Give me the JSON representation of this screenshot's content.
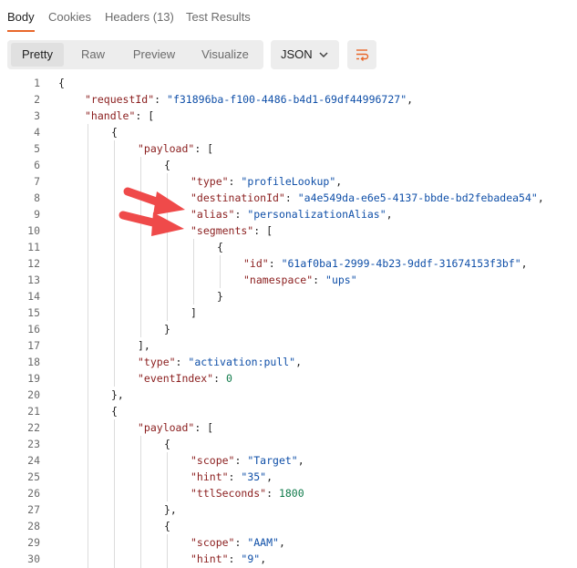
{
  "tabs": {
    "body": "Body",
    "cookies": "Cookies",
    "headers": "Headers (13)",
    "test_results": "Test Results"
  },
  "view_modes": {
    "pretty": "Pretty",
    "raw": "Raw",
    "preview": "Preview",
    "visualize": "Visualize"
  },
  "format": {
    "selected": "JSON"
  },
  "colors": {
    "accent": "#e8672a",
    "key": "#8a1d1d",
    "string": "#0f4fa8",
    "number": "#0f7a4a",
    "arrow": "#ef4a4a"
  },
  "code_lines": [
    {
      "n": "1",
      "indent": 0,
      "tokens": [
        [
          "p",
          "{"
        ]
      ]
    },
    {
      "n": "2",
      "indent": 1,
      "tokens": [
        [
          "k",
          "\"requestId\""
        ],
        [
          "p",
          ": "
        ],
        [
          "s",
          "\"f31896ba-f100-4486-b4d1-69df44996727\""
        ],
        [
          "p",
          ","
        ]
      ]
    },
    {
      "n": "3",
      "indent": 1,
      "tokens": [
        [
          "k",
          "\"handle\""
        ],
        [
          "p",
          ": ["
        ]
      ]
    },
    {
      "n": "4",
      "indent": 2,
      "tokens": [
        [
          "p",
          "{"
        ]
      ]
    },
    {
      "n": "5",
      "indent": 3,
      "tokens": [
        [
          "k",
          "\"payload\""
        ],
        [
          "p",
          ": ["
        ]
      ]
    },
    {
      "n": "6",
      "indent": 4,
      "tokens": [
        [
          "p",
          "{"
        ]
      ]
    },
    {
      "n": "7",
      "indent": 5,
      "tokens": [
        [
          "k",
          "\"type\""
        ],
        [
          "p",
          ": "
        ],
        [
          "s",
          "\"profileLookup\""
        ],
        [
          "p",
          ","
        ]
      ]
    },
    {
      "n": "8",
      "indent": 5,
      "tokens": [
        [
          "k",
          "\"destinationId\""
        ],
        [
          "p",
          ": "
        ],
        [
          "s",
          "\"a4e549da-e6e5-4137-bbde-bd2febadea54\""
        ],
        [
          "p",
          ","
        ]
      ]
    },
    {
      "n": "9",
      "indent": 5,
      "tokens": [
        [
          "k",
          "\"alias\""
        ],
        [
          "p",
          ": "
        ],
        [
          "s",
          "\"personalizationAlias\""
        ],
        [
          "p",
          ","
        ]
      ]
    },
    {
      "n": "10",
      "indent": 5,
      "tokens": [
        [
          "k",
          "\"segments\""
        ],
        [
          "p",
          ": ["
        ]
      ]
    },
    {
      "n": "11",
      "indent": 6,
      "tokens": [
        [
          "p",
          "{"
        ]
      ]
    },
    {
      "n": "12",
      "indent": 7,
      "tokens": [
        [
          "k",
          "\"id\""
        ],
        [
          "p",
          ": "
        ],
        [
          "s",
          "\"61af0ba1-2999-4b23-9ddf-31674153f3bf\""
        ],
        [
          "p",
          ","
        ]
      ]
    },
    {
      "n": "13",
      "indent": 7,
      "tokens": [
        [
          "k",
          "\"namespace\""
        ],
        [
          "p",
          ": "
        ],
        [
          "s",
          "\"ups\""
        ]
      ]
    },
    {
      "n": "14",
      "indent": 6,
      "tokens": [
        [
          "p",
          "}"
        ]
      ]
    },
    {
      "n": "15",
      "indent": 5,
      "tokens": [
        [
          "p",
          "]"
        ]
      ]
    },
    {
      "n": "16",
      "indent": 4,
      "tokens": [
        [
          "p",
          "}"
        ]
      ]
    },
    {
      "n": "17",
      "indent": 3,
      "tokens": [
        [
          "p",
          "],"
        ]
      ]
    },
    {
      "n": "18",
      "indent": 3,
      "tokens": [
        [
          "k",
          "\"type\""
        ],
        [
          "p",
          ": "
        ],
        [
          "s",
          "\"activation:pull\""
        ],
        [
          "p",
          ","
        ]
      ]
    },
    {
      "n": "19",
      "indent": 3,
      "tokens": [
        [
          "k",
          "\"eventIndex\""
        ],
        [
          "p",
          ": "
        ],
        [
          "n",
          "0"
        ]
      ]
    },
    {
      "n": "20",
      "indent": 2,
      "tokens": [
        [
          "p",
          "},"
        ]
      ]
    },
    {
      "n": "21",
      "indent": 2,
      "tokens": [
        [
          "p",
          "{"
        ]
      ]
    },
    {
      "n": "22",
      "indent": 3,
      "tokens": [
        [
          "k",
          "\"payload\""
        ],
        [
          "p",
          ": ["
        ]
      ]
    },
    {
      "n": "23",
      "indent": 4,
      "tokens": [
        [
          "p",
          "{"
        ]
      ]
    },
    {
      "n": "24",
      "indent": 5,
      "tokens": [
        [
          "k",
          "\"scope\""
        ],
        [
          "p",
          ": "
        ],
        [
          "s",
          "\"Target\""
        ],
        [
          "p",
          ","
        ]
      ]
    },
    {
      "n": "25",
      "indent": 5,
      "tokens": [
        [
          "k",
          "\"hint\""
        ],
        [
          "p",
          ": "
        ],
        [
          "s",
          "\"35\""
        ],
        [
          "p",
          ","
        ]
      ]
    },
    {
      "n": "26",
      "indent": 5,
      "tokens": [
        [
          "k",
          "\"ttlSeconds\""
        ],
        [
          "p",
          ": "
        ],
        [
          "n",
          "1800"
        ]
      ]
    },
    {
      "n": "27",
      "indent": 4,
      "tokens": [
        [
          "p",
          "},"
        ]
      ]
    },
    {
      "n": "28",
      "indent": 4,
      "tokens": [
        [
          "p",
          "{"
        ]
      ]
    },
    {
      "n": "29",
      "indent": 5,
      "tokens": [
        [
          "k",
          "\"scope\""
        ],
        [
          "p",
          ": "
        ],
        [
          "s",
          "\"AAM\""
        ],
        [
          "p",
          ","
        ]
      ]
    },
    {
      "n": "30",
      "indent": 5,
      "tokens": [
        [
          "k",
          "\"hint\""
        ],
        [
          "p",
          ": "
        ],
        [
          "s",
          "\"9\""
        ],
        [
          "p",
          ","
        ]
      ]
    }
  ]
}
